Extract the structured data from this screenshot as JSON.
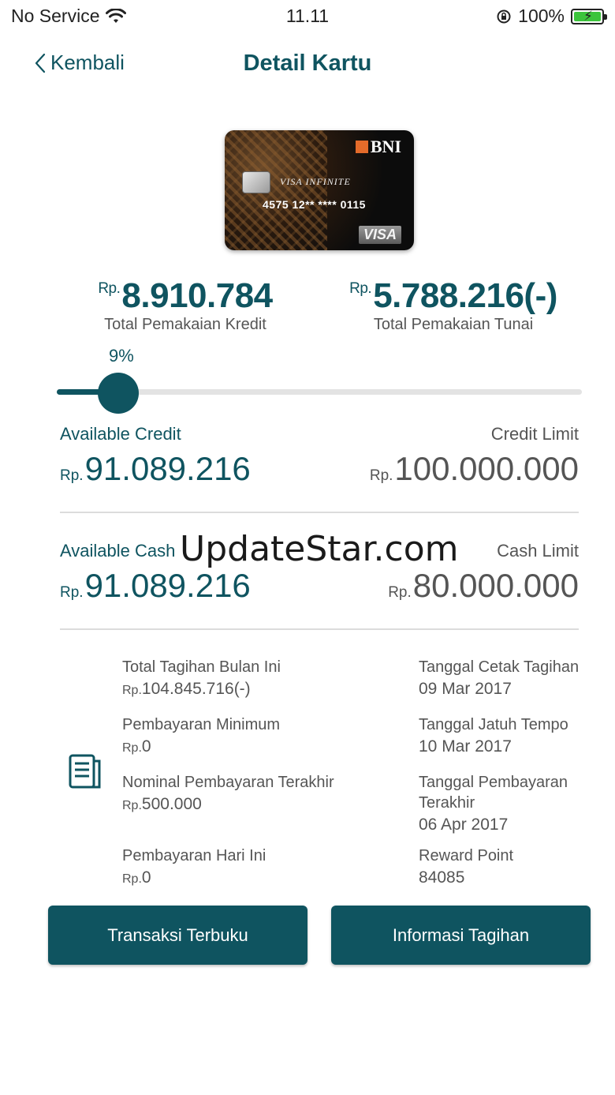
{
  "status_bar": {
    "carrier": "No Service",
    "time": "11.11",
    "battery": "100%",
    "wifi_icon": "wifi-icon",
    "lock_icon": "rotation-lock-icon"
  },
  "nav": {
    "back_label": "Kembali",
    "title": "Detail Kartu"
  },
  "card": {
    "brand": "BNI",
    "tier": "VISA INFINITE",
    "number": "4575 12** **** 0115",
    "network": "VISA"
  },
  "totals": {
    "credit": {
      "currency": "Rp.",
      "amount": "8.910.784",
      "label": "Total Pemakaian Kredit"
    },
    "cash": {
      "currency": "Rp.",
      "amount": "5.788.216(-)",
      "label": "Total Pemakaian Tunai"
    }
  },
  "usage_slider": {
    "percent_label": "9%",
    "value_fraction": 0.09
  },
  "credit": {
    "available_label": "Available Credit",
    "available_currency": "Rp.",
    "available_value": "91.089.216",
    "limit_label": "Credit Limit",
    "limit_currency": "Rp.",
    "limit_value": "100.000.000"
  },
  "cash": {
    "available_label": "Available Cash",
    "available_currency": "Rp.",
    "available_value": "91.089.216",
    "limit_label": "Cash Limit",
    "limit_currency": "Rp.",
    "limit_value": "80.000.000"
  },
  "watermark": "UpdateStar.com",
  "details_left": [
    {
      "label": "Total Tagihan Bulan Ini",
      "currency": "Rp.",
      "value": "104.845.716(-)"
    },
    {
      "label": "Pembayaran Minimum",
      "currency": "Rp.",
      "value": "0"
    },
    {
      "label": "Nominal Pembayaran Terakhir",
      "currency": "Rp.",
      "value": "500.000"
    },
    {
      "label": "Pembayaran Hari Ini",
      "currency": "Rp.",
      "value": "0"
    }
  ],
  "details_right": [
    {
      "label": "Tanggal Cetak Tagihan",
      "value": "09 Mar 2017"
    },
    {
      "label": "Tanggal Jatuh Tempo",
      "value": "10 Mar 2017"
    },
    {
      "label": "Tanggal Pembayaran",
      "label2": "Terakhir",
      "value": "06 Apr 2017"
    },
    {
      "label": "Reward Point",
      "value": "84085"
    }
  ],
  "buttons": {
    "open_transactions": "Transaksi Terbuku",
    "bill_info": "Informasi Tagihan"
  },
  "colors": {
    "accent": "#0f5460",
    "track": "#e3e3e3",
    "battery": "#3cc43c"
  }
}
